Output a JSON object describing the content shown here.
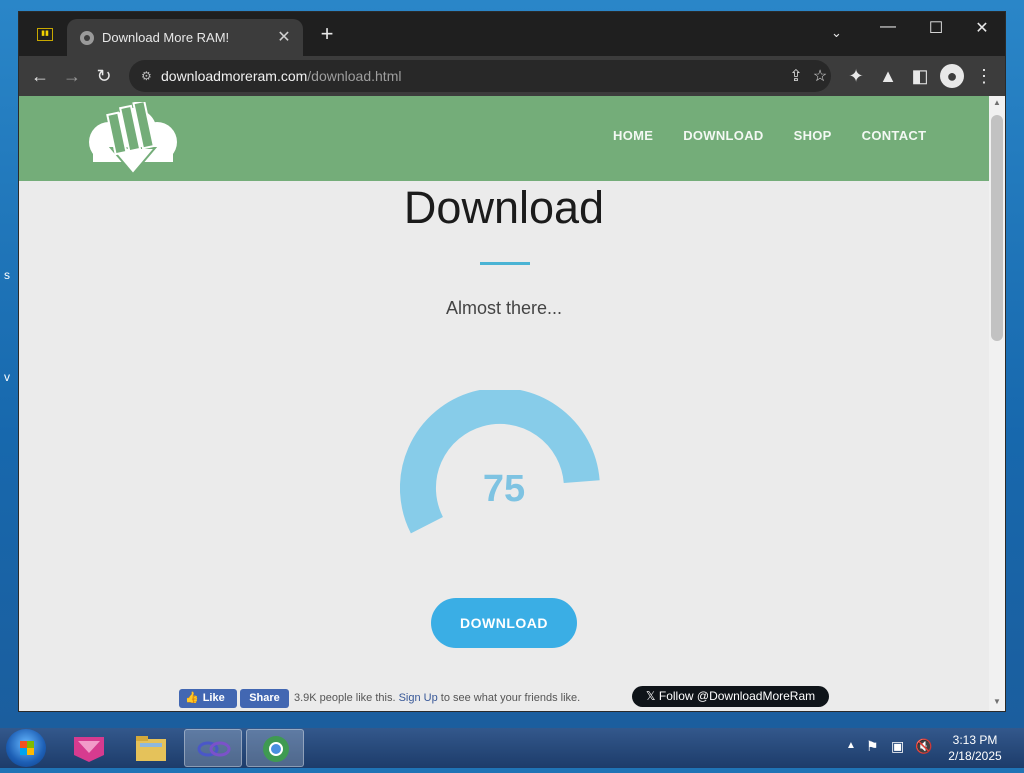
{
  "browser": {
    "tab": {
      "title": "Download More RAM!"
    },
    "url": {
      "domain": "downloadmoreram.com",
      "path": "/download.html"
    }
  },
  "site": {
    "nav": [
      "HOME",
      "DOWNLOAD",
      "SHOP",
      "CONTACT"
    ],
    "heading": "Download",
    "subheading": "Almost there...",
    "progress": {
      "value": "75",
      "fraction": 0.75
    },
    "download_button": "DOWNLOAD",
    "facebook": {
      "like_label": "Like",
      "share_label": "Share",
      "text_prefix": "3.9K people like this.",
      "signup_link": "Sign Up",
      "text_suffix": "to see what your friends like."
    },
    "x_follow": "Follow @DownloadMoreRam"
  },
  "taskbar": {
    "clock_time": "3:13 PM",
    "clock_date": "2/18/2025"
  },
  "colors": {
    "header_green": "#74ad79",
    "accent_blue": "#3aaee5",
    "gauge_blue": "#87cce9"
  }
}
